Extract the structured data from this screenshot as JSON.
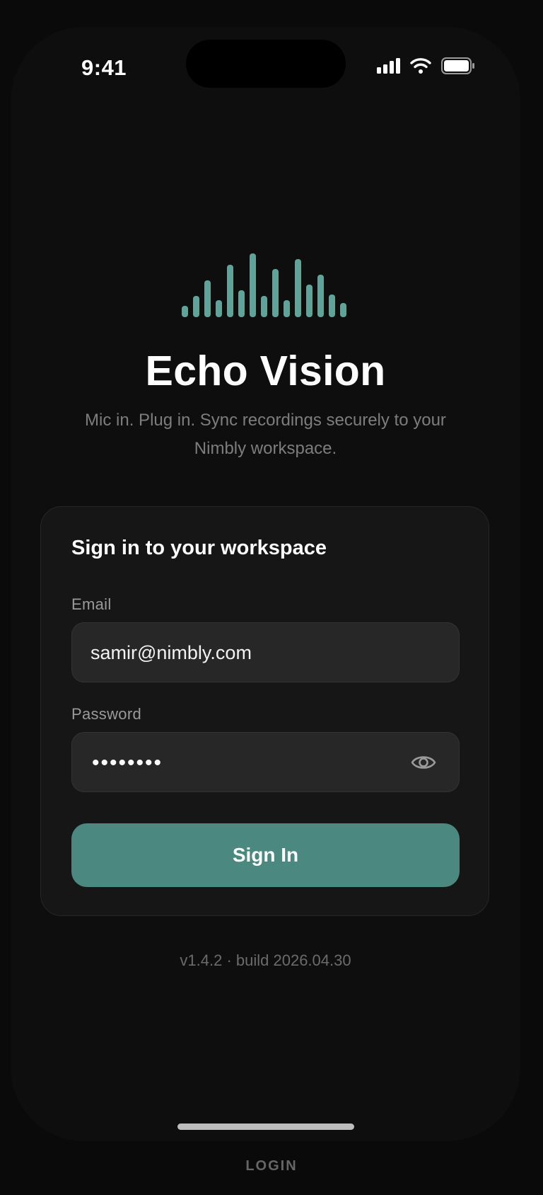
{
  "status_bar": {
    "time": "9:41"
  },
  "app": {
    "name": "Echo Vision",
    "tagline": "Mic in. Plug in. Sync recordings securely to your Nimbly workspace."
  },
  "login_card": {
    "title": "Sign in to your workspace",
    "email": {
      "label": "Email",
      "value": "samir@nimbly.com"
    },
    "password": {
      "label": "Password",
      "masked_value": "••••••••"
    },
    "submit_label": "Sign In"
  },
  "footer": {
    "version": "v1.4.2 · build 2026.04.30"
  },
  "screen_label": "LOGIN",
  "colors": {
    "accent": "#4a8880",
    "logo_bar": "#5da59b",
    "background": "#0e0e0e",
    "card": "#161616"
  },
  "icons": {
    "signal": "cellular-signal-icon",
    "wifi": "wifi-icon",
    "battery": "battery-icon",
    "logo": "waveform-logo-icon",
    "reveal": "eye-icon"
  }
}
